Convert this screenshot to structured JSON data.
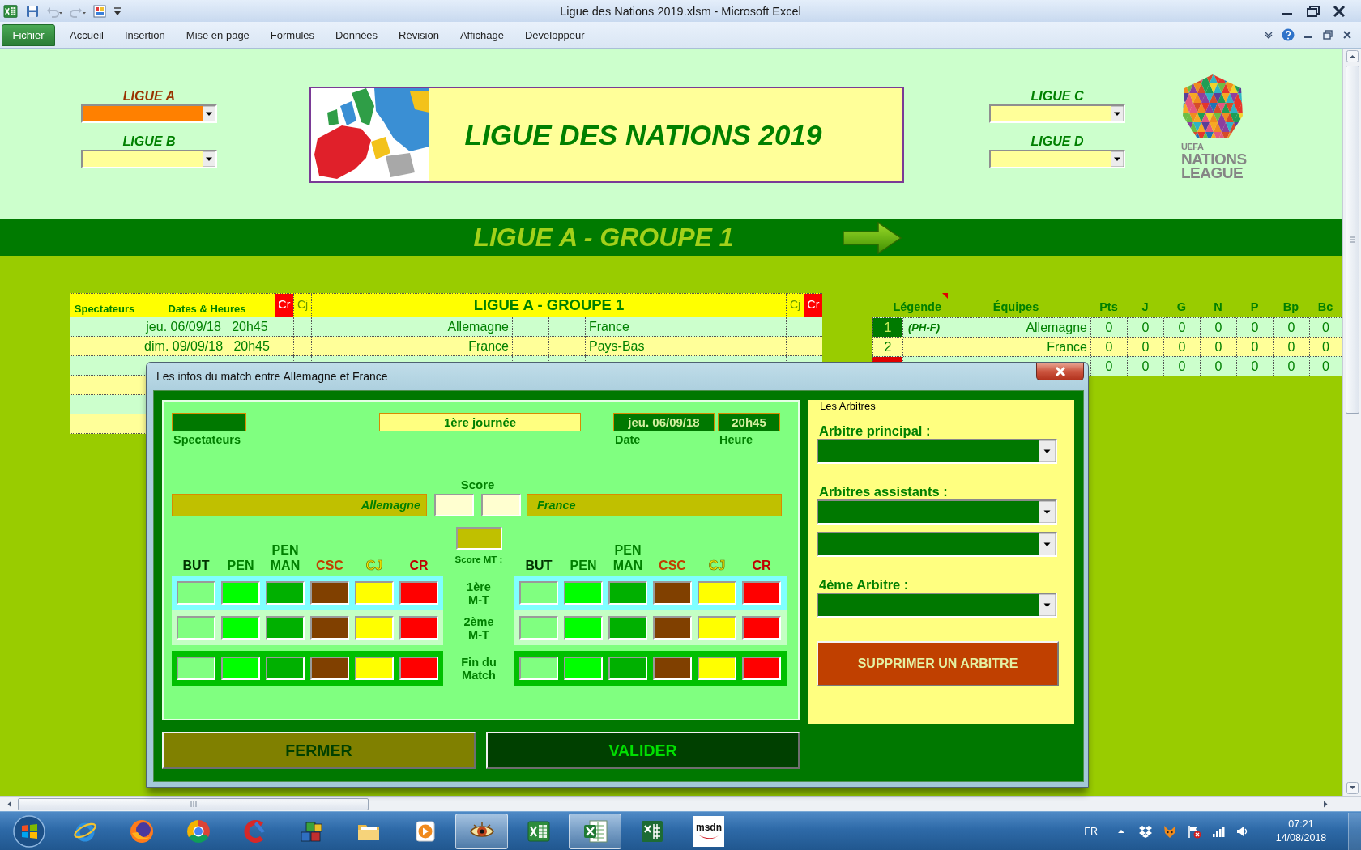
{
  "window": {
    "title": "Ligue des Nations 2019.xlsm - Microsoft Excel"
  },
  "quick_access": [
    {
      "kind": "save",
      "disabled": false
    },
    {
      "kind": "undo",
      "disabled": true
    },
    {
      "kind": "redo",
      "disabled": true
    },
    {
      "kind": "form",
      "disabled": false
    }
  ],
  "ribbon_tabs": [
    {
      "label": "Fichier",
      "kind": "menu"
    },
    {
      "label": "Accueil",
      "kind": "tab"
    },
    {
      "label": "Insertion",
      "kind": "tab"
    },
    {
      "label": "Mise en page",
      "kind": "tab"
    },
    {
      "label": "Formules",
      "kind": "tab"
    },
    {
      "label": "Données",
      "kind": "tab"
    },
    {
      "label": "Révision",
      "kind": "tab"
    },
    {
      "label": "Affichage",
      "kind": "tab"
    },
    {
      "label": "Développeur",
      "kind": "tab"
    }
  ],
  "sheet": {
    "league_selectors": [
      {
        "label": "LIGUE A",
        "selected": true
      },
      {
        "label": "LIGUE B",
        "selected": false
      },
      {
        "label": "LIGUE C",
        "selected": false
      },
      {
        "label": "LIGUE D",
        "selected": false
      }
    ],
    "banner_title": "LIGUE DES NATIONS 2019",
    "logo_lines": [
      "UEFA",
      "NATIONS",
      "LEAGUE"
    ],
    "group_banner": "LIGUE A - GROUPE 1",
    "matches": {
      "columns": [
        {
          "label": "Spectateurs",
          "kind": "spectators"
        },
        {
          "label": "Dates & Heures",
          "kind": "datetime"
        },
        {
          "label": "Cr",
          "kind": "red_card"
        },
        {
          "label": "Cj",
          "kind": "yellow_card"
        },
        {
          "label": "LIGUE A - GROUPE 1",
          "kind": "fixture"
        },
        {
          "label": "Cj",
          "kind": "yellow_card"
        },
        {
          "label": "Cr",
          "kind": "red_card"
        }
      ],
      "rows": [
        {
          "datetime": "jeu. 06/09/18   20h45",
          "home": "Allemagne",
          "away": "France"
        },
        {
          "datetime": "dim. 09/09/18   20h45",
          "home": "France",
          "away": "Pays-Bas"
        }
      ]
    },
    "standings": {
      "columns": [
        {
          "label": "Légende",
          "comment": true
        },
        {
          "label": "Équipes",
          "comment": false
        },
        {
          "label": "Pts",
          "comment": false
        },
        {
          "label": "J",
          "comment": false
        },
        {
          "label": "G",
          "comment": false
        },
        {
          "label": "N",
          "comment": false
        },
        {
          "label": "P",
          "comment": false
        },
        {
          "label": "Bp",
          "comment": false
        },
        {
          "label": "Bc",
          "comment": false
        }
      ],
      "rows": [
        {
          "rank": "1",
          "color": "#007a00",
          "note": "(PH-F)",
          "team": "Allemagne",
          "values": [
            "0",
            "0",
            "0",
            "0",
            "0",
            "0",
            "0"
          ]
        },
        {
          "rank": "2",
          "color": "#ffff99",
          "team": "France",
          "values": [
            "0",
            "0",
            "0",
            "0",
            "0",
            "0",
            "0"
          ]
        },
        {
          "color": "#e00000",
          "values": [
            "0",
            "0",
            "0",
            "0",
            "0",
            "0",
            "0"
          ]
        }
      ]
    }
  },
  "dialog": {
    "title": "Les infos du match entre Allemagne et France",
    "spectators_label": "Spectateurs",
    "matchday": "1ère journée",
    "date": {
      "value": "jeu. 06/09/18",
      "label": "Date"
    },
    "time": {
      "value": "20h45",
      "label": "Heure"
    },
    "score_label": "Score",
    "home_team": "Allemagne",
    "away_team": "France",
    "halftime_label": "Score MT :",
    "home_columns": [
      {
        "label": "BUT",
        "kind": "goal"
      },
      {
        "label": "PEN",
        "kind": "penalty"
      },
      {
        "label": "PEN MAN",
        "kind": "missed_penalty"
      },
      {
        "label": "CSC",
        "kind": "own_goal"
      },
      {
        "label": "CJ",
        "kind": "yellow_card"
      },
      {
        "label": "CR",
        "kind": "red_card"
      }
    ],
    "away_columns": [
      {
        "label": "BUT",
        "kind": "goal"
      },
      {
        "label": "PEN",
        "kind": "penalty"
      },
      {
        "label": "PEN MAN",
        "kind": "missed_penalty"
      },
      {
        "label": "CSC",
        "kind": "own_goal"
      },
      {
        "label": "CJ",
        "kind": "yellow_card"
      },
      {
        "label": "CR",
        "kind": "red_card"
      }
    ],
    "periods": [
      {
        "label": "1ère M-T",
        "kind": "first_half"
      },
      {
        "label": "2ème M-T",
        "kind": "second_half"
      },
      {
        "label": "Fin du Match",
        "kind": "full_time"
      }
    ],
    "referees": {
      "caption": "Les Arbitres",
      "items": [
        {
          "kind": "label",
          "text": "Arbitre principal :"
        },
        {
          "kind": "dropdown"
        },
        {
          "kind": "label",
          "text": "Arbitres assistants :"
        },
        {
          "kind": "dropdown"
        },
        {
          "kind": "dropdown"
        },
        {
          "kind": "label",
          "text": "4ème Arbitre :"
        },
        {
          "kind": "dropdown"
        }
      ],
      "delete_button": "SUPPRIMER UN ARBITRE"
    },
    "buttons": [
      {
        "label": "FERMER",
        "kind": "close"
      },
      {
        "label": "VALIDER",
        "kind": "confirm"
      }
    ]
  },
  "taskbar": {
    "apps": [
      {
        "kind": "ring",
        "active": false
      },
      {
        "kind": "globe",
        "active": false
      },
      {
        "kind": "pinwheel",
        "active": false
      },
      {
        "kind": "arc",
        "active": false
      },
      {
        "kind": "boxes",
        "active": false
      },
      {
        "kind": "folder",
        "active": false
      },
      {
        "kind": "play",
        "active": false
      },
      {
        "kind": "eye",
        "active": true
      },
      {
        "kind": "sheet",
        "active": false
      },
      {
        "kind": "sheet_page",
        "active": true
      },
      {
        "kind": "sheet_bar",
        "active": false
      },
      {
        "kind": "logo",
        "label": "msdn",
        "active": false
      }
    ],
    "language": "FR",
    "time": "07:21",
    "date": "14/08/2018"
  }
}
